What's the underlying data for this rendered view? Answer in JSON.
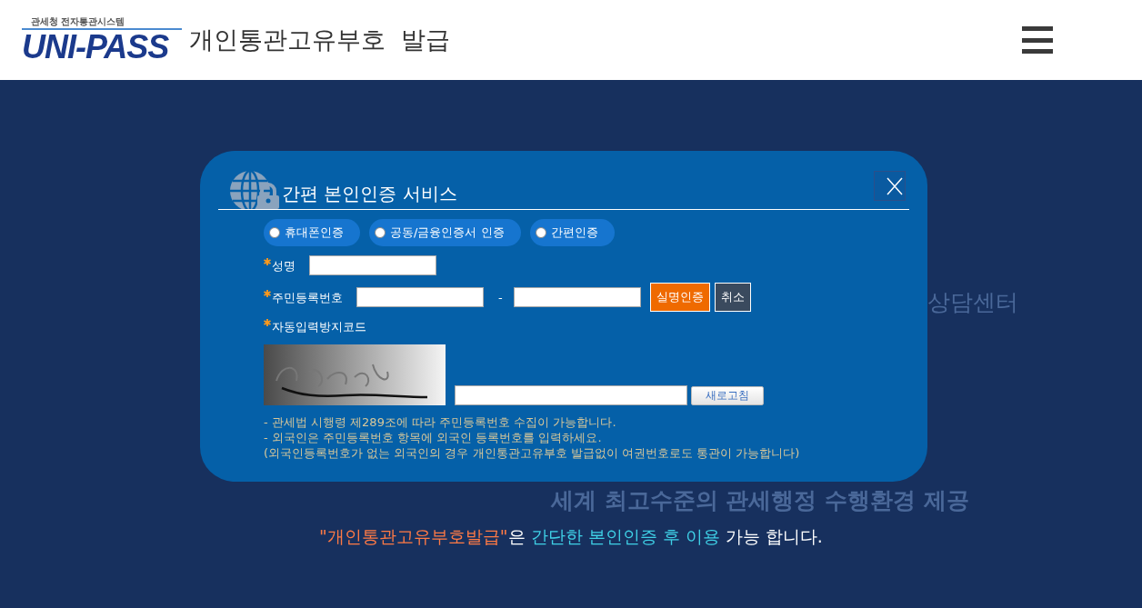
{
  "header": {
    "logo_caption": "관세청 전자통관시스템",
    "logo_text": "UNI-PASS",
    "title": "개인통관고유부호  발급"
  },
  "background_texts": [
    {
      "text": "상담센터",
      "kind": "side"
    },
    {
      "text": "세계 최고수준의 관세행정 수행환경 제공",
      "kind": "bottom"
    }
  ],
  "dialog": {
    "title": "간편 본인인증 서비스",
    "auth_options": [
      {
        "label": "휴대폰인증",
        "selected": false
      },
      {
        "label": "공동/금융인증서 인증",
        "selected": false
      },
      {
        "label": "간편인증",
        "selected": false
      }
    ],
    "name_field": {
      "label": "성명",
      "required": true
    },
    "rrn_field": {
      "label": "주민등록번호",
      "required": true,
      "separator": "-",
      "verify_button": "실명인증",
      "cancel_button": "취소"
    },
    "captcha_field": {
      "label": "자동입력방지코드",
      "required": true,
      "refresh_button": "새로고침"
    },
    "notes": [
      "- 관세법 시행령 제289조에 따라 주민등록번호 수집이 가능합니다.",
      "- 외국인은 주민등록번호 항목에 외국인 등록번호를 입력하세요.",
      "(외국인등록번호가 없는 외국인의 경우 개인통관고유부호 발급없이 여권번호로도 통관이 가능합니다)"
    ]
  },
  "footer_message": [
    {
      "text": "\"개인통관고유부호발급\"",
      "kind": "title"
    },
    {
      "text": "은 ",
      "kind": "plain"
    },
    {
      "text": "간단한 본인인증 후 이용",
      "kind": "highlight"
    },
    {
      "text": " 가능 합니다.",
      "kind": "plain"
    }
  ]
}
